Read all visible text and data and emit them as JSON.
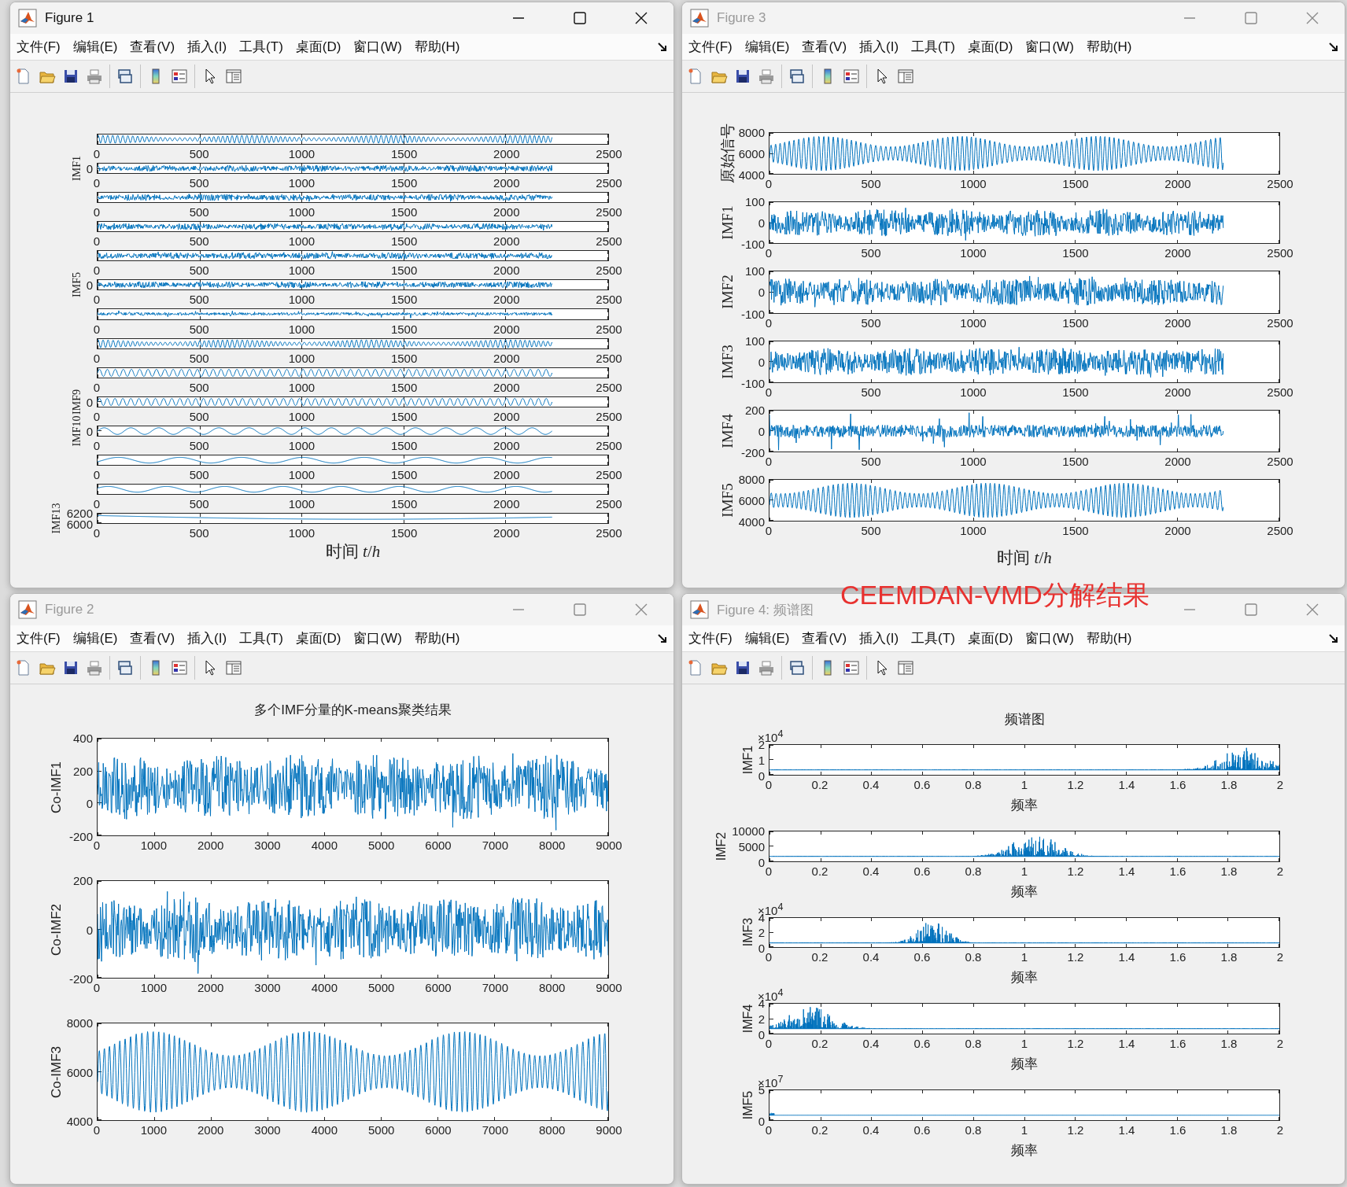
{
  "annotation": "CEEMDAN-VMD分解结果",
  "windows": [
    {
      "title": "Figure 1",
      "active": true,
      "menu": [
        "文件(F)",
        "编辑(E)",
        "查看(V)",
        "插入(I)",
        "工具(T)",
        "桌面(D)",
        "窗口(W)",
        "帮助(H)"
      ],
      "xlabel": "时间 *t*/*h*",
      "axes": [
        {
          "xticks": [
            "0",
            "500",
            "1000",
            "1500",
            "2000",
            "2500"
          ]
        },
        {
          "ylabel": "IMF1",
          "yticks": [
            "0"
          ],
          "xticks": [
            "0",
            "500",
            "1000",
            "1500",
            "2000",
            "2500"
          ]
        },
        {
          "xticks": [
            "0",
            "500",
            "1000",
            "1500",
            "2000",
            "2500"
          ]
        },
        {
          "xticks": [
            "0",
            "500",
            "1000",
            "1500",
            "2000",
            "2500"
          ]
        },
        {
          "xticks": [
            "0",
            "500",
            "1000",
            "1500",
            "2000",
            "2500"
          ]
        },
        {
          "ylabel": "IMF5",
          "yticks": [
            "0"
          ],
          "xticks": [
            "0",
            "500",
            "1000",
            "1500",
            "2000",
            "2500"
          ]
        },
        {
          "xticks": [
            "0",
            "500",
            "1000",
            "1500",
            "2000",
            "2500"
          ]
        },
        {
          "xticks": [
            "0",
            "500",
            "1000",
            "1500",
            "2000",
            "2500"
          ]
        },
        {
          "xticks": [
            "0",
            "500",
            "1000",
            "1500",
            "2000",
            "2500"
          ]
        },
        {
          "ylabel": "IMF9",
          "yticks": [
            "0"
          ],
          "xticks": [
            "0",
            "500",
            "1000",
            "1500",
            "2000",
            "2500"
          ]
        },
        {
          "ylabel": "IMF10",
          "yticks": [
            "0"
          ],
          "xticks": [
            "0",
            "500",
            "1000",
            "1500",
            "2000",
            "2500"
          ]
        },
        {
          "xticks": [
            "0",
            "500",
            "1000",
            "1500",
            "2000",
            "2500"
          ]
        },
        {
          "xticks": [
            "0",
            "500",
            "1000",
            "1500",
            "2000",
            "2500"
          ]
        },
        {
          "ylabel": "IMF13",
          "yticks": [
            "6200",
            "6000"
          ],
          "xticks": [
            "0",
            "500",
            "1000",
            "1500",
            "2000",
            "2500"
          ]
        }
      ]
    },
    {
      "title": "Figure 3",
      "active": false,
      "menu": [
        "文件(F)",
        "编辑(E)",
        "查看(V)",
        "插入(I)",
        "工具(T)",
        "桌面(D)",
        "窗口(W)",
        "帮助(H)"
      ],
      "xlabel": "时间 *t*/*h*",
      "axes": [
        {
          "ylabel": "原始信号",
          "yticks": [
            "8000",
            "6000",
            "4000"
          ],
          "xticks": [
            "0",
            "500",
            "1000",
            "1500",
            "2000",
            "2500"
          ]
        },
        {
          "ylabel": "IMF1",
          "yticks": [
            "100",
            "0",
            "-100"
          ],
          "xticks": [
            "0",
            "500",
            "1000",
            "1500",
            "2000",
            "2500"
          ]
        },
        {
          "ylabel": "IMF2",
          "yticks": [
            "100",
            "0",
            "-100"
          ],
          "xticks": [
            "0",
            "500",
            "1000",
            "1500",
            "2000",
            "2500"
          ]
        },
        {
          "ylabel": "IMF3",
          "yticks": [
            "100",
            "0",
            "-100"
          ],
          "xticks": [
            "0",
            "500",
            "1000",
            "1500",
            "2000",
            "2500"
          ]
        },
        {
          "ylabel": "IMF4",
          "yticks": [
            "200",
            "0",
            "-200"
          ],
          "xticks": [
            "0",
            "500",
            "1000",
            "1500",
            "2000",
            "2500"
          ]
        },
        {
          "ylabel": "IMF5",
          "yticks": [
            "8000",
            "6000",
            "4000"
          ],
          "xticks": [
            "0",
            "500",
            "1000",
            "1500",
            "2000",
            "2500"
          ]
        }
      ]
    },
    {
      "title": "Figure 2",
      "active": false,
      "menu": [
        "文件(F)",
        "编辑(E)",
        "查看(V)",
        "插入(I)",
        "工具(T)",
        "桌面(D)",
        "窗口(W)",
        "帮助(H)"
      ],
      "plot_title": "多个IMF分量的K-means聚类结果",
      "axes": [
        {
          "ylabel": "Co-IMF1",
          "yticks": [
            "400",
            "200",
            "0",
            "-200"
          ],
          "xticks": [
            "0",
            "1000",
            "2000",
            "3000",
            "4000",
            "5000",
            "6000",
            "7000",
            "8000",
            "9000"
          ]
        },
        {
          "ylabel": "Co-IMF2",
          "yticks": [
            "200",
            "0",
            "-200"
          ],
          "xticks": [
            "0",
            "1000",
            "2000",
            "3000",
            "4000",
            "5000",
            "6000",
            "7000",
            "8000",
            "9000"
          ]
        },
        {
          "ylabel": "Co-IMF3",
          "yticks": [
            "8000",
            "6000",
            "4000"
          ],
          "xticks": [
            "0",
            "1000",
            "2000",
            "3000",
            "4000",
            "5000",
            "6000",
            "7000",
            "8000",
            "9000"
          ]
        }
      ]
    },
    {
      "title": "Figure 4: 频谱图",
      "active": false,
      "menu": [
        "文件(F)",
        "编辑(E)",
        "查看(V)",
        "插入(I)",
        "工具(T)",
        "桌面(D)",
        "窗口(W)",
        "帮助(H)"
      ],
      "plot_title": "频谱图",
      "axes": [
        {
          "exponent": "×10$^{4}$",
          "ylabel": "IMF1",
          "yticks": [
            "2",
            "1",
            "0"
          ],
          "xticks": [
            "0",
            "0.2",
            "0.4",
            "0.6",
            "0.8",
            "1",
            "1.2",
            "1.4",
            "1.6",
            "1.8",
            "2"
          ],
          "xlabel": "频率"
        },
        {
          "ylabel": "IMF2",
          "yticks": [
            "10000",
            "5000",
            "0"
          ],
          "xticks": [
            "0",
            "0.2",
            "0.4",
            "0.6",
            "0.8",
            "1",
            "1.2",
            "1.4",
            "1.6",
            "1.8",
            "2"
          ],
          "xlabel": "频率"
        },
        {
          "exponent": "×10$^{4}$",
          "ylabel": "IMF3",
          "yticks": [
            "4",
            "2",
            "0"
          ],
          "xticks": [
            "0",
            "0.2",
            "0.4",
            "0.6",
            "0.8",
            "1",
            "1.2",
            "1.4",
            "1.6",
            "1.8",
            "2"
          ],
          "xlabel": "频率"
        },
        {
          "exponent": "×10$^{4}$",
          "ylabel": "IMF4",
          "yticks": [
            "4",
            "2",
            "0"
          ],
          "xticks": [
            "0",
            "0.2",
            "0.4",
            "0.6",
            "0.8",
            "1",
            "1.2",
            "1.4",
            "1.6",
            "1.8",
            "2"
          ],
          "xlabel": "频率"
        },
        {
          "exponent": "×10$^{7}$",
          "ylabel": "IMF5",
          "yticks": [
            "5",
            "0"
          ],
          "xticks": [
            "0",
            "0.2",
            "0.4",
            "0.6",
            "0.8",
            "1",
            "1.2",
            "1.4",
            "1.6",
            "1.8",
            "2"
          ],
          "xlabel": "频率"
        }
      ]
    }
  ]
}
